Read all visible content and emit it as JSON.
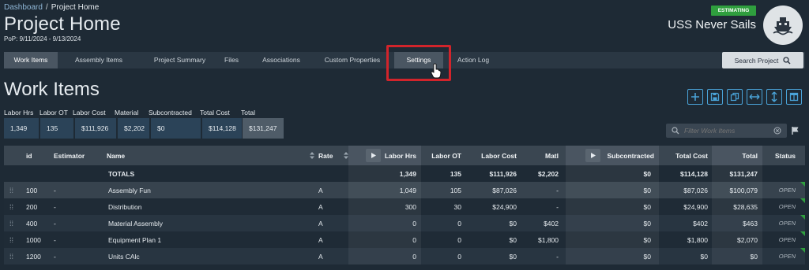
{
  "breadcrumb": {
    "link": "Dashboard",
    "separator": "/",
    "current": "Project Home"
  },
  "page": {
    "title": "Project Home",
    "pop": "PoP: 9/11/2024 - 9/13/2024"
  },
  "project": {
    "status_badge": "ESTIMATING",
    "name": "USS Never Sails",
    "avatar_icon": "ship-icon"
  },
  "tabs": [
    "Work Items",
    "Assembly Items",
    "Project Summary",
    "Files",
    "Associations",
    "Custom Properties",
    "Settings",
    "Action Log"
  ],
  "active_tab": "Work Items",
  "highlighted_tab": "Settings",
  "search_project": {
    "label": "Search Project",
    "icon": "search-icon"
  },
  "section": {
    "title": "Work Items"
  },
  "summary": {
    "labels": [
      "Labor Hrs",
      "Labor OT",
      "Labor Cost",
      "Material",
      "Subcontracted",
      "Total Cost",
      "Total"
    ],
    "values": [
      "1,349",
      "135",
      "$111,926",
      "$2,202",
      "$0",
      "$114,128",
      "$131,247"
    ]
  },
  "toolbar_icons": [
    "plus-icon",
    "save-icon",
    "copy-icon",
    "expand-horizontal-icon",
    "expand-vertical-icon",
    "columns-icon"
  ],
  "filter": {
    "placeholder": "Filter Work Items",
    "icon": "search-icon"
  },
  "grid": {
    "headers": {
      "id": "id",
      "estimator": "Estimator",
      "name": "Name",
      "rate": "Rate",
      "labor_hrs": "Labor Hrs",
      "labor_ot": "Labor OT",
      "labor_cost": "Labor Cost",
      "matl": "Matl",
      "subcontracted": "Subcontracted",
      "total_cost": "Total Cost",
      "total": "Total",
      "status": "Status"
    },
    "totals": {
      "label": "TOTALS",
      "labor_hrs": "1,349",
      "labor_ot": "135",
      "labor_cost": "$111,926",
      "matl": "$2,202",
      "subcontracted": "$0",
      "total_cost": "$114,128",
      "total": "$131,247"
    },
    "rows": [
      {
        "id": "100",
        "estimator": "-",
        "name": "Assembly Fun",
        "rate": "A",
        "labor_hrs": "1,049",
        "labor_ot": "105",
        "labor_cost": "$87,026",
        "matl": "-",
        "subcontracted": "$0",
        "total_cost": "$87,026",
        "total": "$100,079",
        "status": "OPEN"
      },
      {
        "id": "200",
        "estimator": "-",
        "name": "Distribution",
        "rate": "A",
        "labor_hrs": "300",
        "labor_ot": "30",
        "labor_cost": "$24,900",
        "matl": "-",
        "subcontracted": "$0",
        "total_cost": "$24,900",
        "total": "$28,635",
        "status": "OPEN"
      },
      {
        "id": "400",
        "estimator": "-",
        "name": "Material Assembly",
        "rate": "A",
        "labor_hrs": "0",
        "labor_ot": "0",
        "labor_cost": "$0",
        "matl": "$402",
        "subcontracted": "$0",
        "total_cost": "$402",
        "total": "$463",
        "status": "OPEN"
      },
      {
        "id": "1000",
        "estimator": "-",
        "name": "Equipment Plan 1",
        "rate": "A",
        "labor_hrs": "0",
        "labor_ot": "0",
        "labor_cost": "$0",
        "matl": "$1,800",
        "subcontracted": "$0",
        "total_cost": "$1,800",
        "total": "$2,070",
        "status": "OPEN"
      },
      {
        "id": "1200",
        "estimator": "-",
        "name": "Units CAlc",
        "rate": "A",
        "labor_hrs": "0",
        "labor_ot": "0",
        "labor_cost": "$0",
        "matl": "-",
        "subcontracted": "$0",
        "total_cost": "$0",
        "total": "$0",
        "status": "OPEN"
      }
    ]
  },
  "colors": {
    "background": "#1e2a35",
    "accent": "#4aa3d8",
    "badge": "#2f9e3e",
    "highlight_ring": "#d2242b"
  }
}
